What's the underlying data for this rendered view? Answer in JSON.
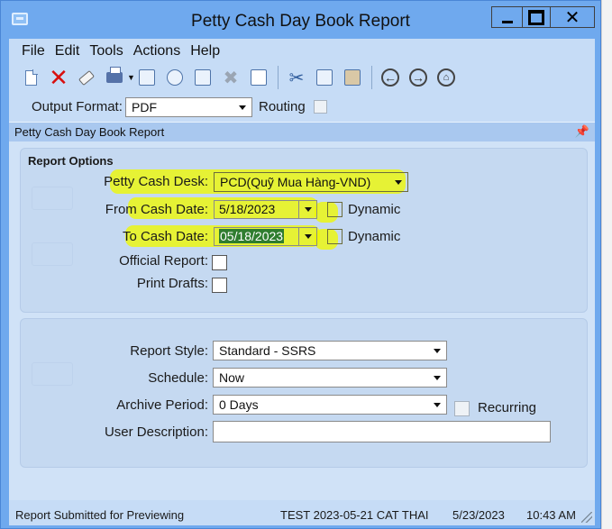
{
  "window": {
    "title": "Petty Cash Day Book Report",
    "close_glyph": "✕"
  },
  "menu": [
    "File",
    "Edit",
    "Tools",
    "Actions",
    "Help"
  ],
  "toolbar": {
    "icons": [
      "new-document-icon",
      "delete-icon",
      "eraser-icon",
      "print-icon",
      "print-preview-icon",
      "export-icon",
      "copy-to-icon",
      "cancel-icon",
      "excel-icon",
      "cut-icon",
      "copy-icon",
      "paste-icon",
      "back-icon",
      "forward-icon",
      "home-icon"
    ]
  },
  "output": {
    "label": "Output Format:",
    "value": "PDF",
    "routing_label": "Routing",
    "routing_checked": false
  },
  "section": {
    "title": "Petty Cash Day Book Report",
    "pin_glyph": "📌"
  },
  "report_options": {
    "title": "Report Options",
    "petty_cash_desk": {
      "label": "Petty Cash Desk:",
      "value": "PCD(Quỹ Mua Hàng-VND)"
    },
    "from_cash_date": {
      "label": "From Cash Date:",
      "value": "5/18/2023",
      "dynamic_label": "Dynamic",
      "dynamic_checked": false
    },
    "to_cash_date": {
      "label": "To Cash Date:",
      "value": "05/18/2023",
      "dynamic_label": "Dynamic",
      "dynamic_checked": false
    },
    "official_report": {
      "label": "Official Report:",
      "checked": false
    },
    "print_drafts": {
      "label": "Print Drafts:",
      "checked": false
    }
  },
  "schedule_options": {
    "report_style": {
      "label": "Report Style:",
      "value": "Standard - SSRS"
    },
    "schedule": {
      "label": "Schedule:",
      "value": "Now"
    },
    "archive_period": {
      "label": "Archive Period:",
      "value": "0 Days",
      "recurring_label": "Recurring",
      "recurring_checked": false
    },
    "user_description": {
      "label": "User Description:",
      "value": ""
    }
  },
  "status": {
    "message": "Report Submitted for Previewing",
    "session": "TEST 2023-05-21 CAT THAI",
    "date": "5/23/2023",
    "time": "10:43 AM"
  },
  "colors": {
    "title_bar": "#6fa9ee",
    "client": "#c6dcf6",
    "highlight": "#f0f800",
    "selection": "#2f7d2f"
  }
}
